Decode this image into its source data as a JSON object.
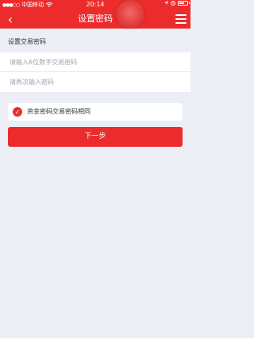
{
  "status_bar": {
    "signal_dots": "●●●○○",
    "carrier": "中国移动",
    "wifi_icon": "wifi-icon",
    "time": "20:14",
    "right_icons": [
      "location-icon",
      "alarm-icon",
      "battery-icon"
    ]
  },
  "header": {
    "title": "设置密码",
    "back_icon": "‹",
    "menu_icon": "menu-icon"
  },
  "form": {
    "section_label": "设置交易密码",
    "password_placeholder": "请输入6位数字交易密码",
    "confirm_placeholder": "请再次输入密码",
    "same_password_label": "资金密码交易密码相同",
    "same_password_checked": true,
    "next_button": "下一步"
  },
  "colors": {
    "accent": "#ec2c2c",
    "background": "#eceef5"
  }
}
